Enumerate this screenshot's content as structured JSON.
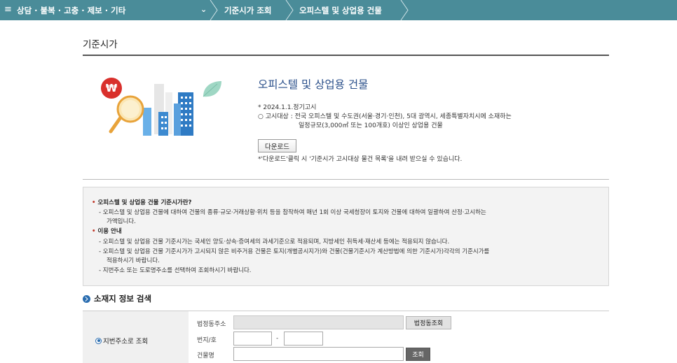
{
  "topbar": {
    "menu_icon": "≡",
    "category": "상담 · 불복 · 고충 · 제보 · 기타",
    "dropdown_icon": "⌄",
    "crumb1": "기준시가 조회",
    "crumb2": "오피스텔 및 상업용 건물",
    "color": "#4a8c99"
  },
  "page": {
    "title": "기준시가"
  },
  "product": {
    "title": "오피스텔 및 상업용 건물",
    "notice_date": "* 2024.1.1.정기고시",
    "target_line1": "○ 고시대상 : 전국 오피스텔 및 수도권(서울·경기·인천), 5대 광역시, 세종특별자치시에 소재하는",
    "target_line2": "일정규모(3,000㎡ 또는 100개호) 이상인 상업용 건물",
    "download_label": "다운로드",
    "download_note": "*'다운로드'클릭 시 '기준시가 고시대상 물건 목록'을 내려 받으실 수 있습니다."
  },
  "explain": {
    "h1": "오피스텔 및 상업용 건물 기준시가란?",
    "p1a": "- 오피스텔 및 상업용 건물에 대하여 건물의 종류·규모·거래상황·위치 등을 참작하여 매년 1회 이상 국세청장이 토지와 건물에 대하여 일괄하여 산정·고시하는",
    "p1b": "가액입니다.",
    "h2": "이용 안내",
    "p2": "- 오피스텔 및 상업용 건물 기준시가는 국세인 양도·상속·증여세의 과세기준으로 적용되며, 지방세인 취득세·재산세 등에는 적용되지 않습니다.",
    "p3a": "- 오피스텔 및 상업용 건물 기준시가가 고시되지 않은 비주거용 건물은 토지(개별공시지가)와 건물(건물기준시가 계산방법에 의한 기준시가)각각의 기준시가를",
    "p3b": "적용하시기 바랍니다.",
    "p4": "- 지번주소 또는 도로명주소를 선택하여 조회하시기 바랍니다.",
    "bullet": "•"
  },
  "search": {
    "heading": "소재지 정보 검색",
    "radio_label": "지번주소로 조회",
    "dong_label": "법정동주소",
    "dong_value": "",
    "dong_button": "법정동조회",
    "bunji_label": "번지/호",
    "bunji_value": "",
    "ho_value": "",
    "dash": "-",
    "building_label": "건물명",
    "building_value": "",
    "search_button": "조회"
  }
}
